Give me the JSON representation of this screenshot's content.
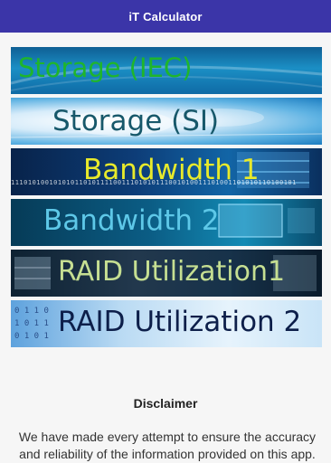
{
  "app": {
    "title": "iT Calculator"
  },
  "menu": {
    "items": [
      {
        "label": "Storage (IEC)"
      },
      {
        "label": "Storage (SI)"
      },
      {
        "label": "Bandwidth 1"
      },
      {
        "label": "Bandwidth 2"
      },
      {
        "label": "RAID Utilization1"
      },
      {
        "label": "RAID Utilization 2"
      }
    ],
    "binary_strip": "1110101001010101101011110011101010111001010011101001101010110100101"
  },
  "disclaimer": {
    "title": "Disclaimer",
    "text": "We have made every attempt to ensure the accuracy and reliability of the information provided on this app."
  },
  "colors": {
    "appbar": "#3b35a8",
    "label_storage_iec": "#1fb52c",
    "label_storage_si": "#17586a",
    "label_bandwidth1": "#e8ea2b",
    "label_bandwidth2": "#5ec8e8",
    "label_raid1": "#c6df92",
    "label_raid2": "#0d1f4a"
  }
}
